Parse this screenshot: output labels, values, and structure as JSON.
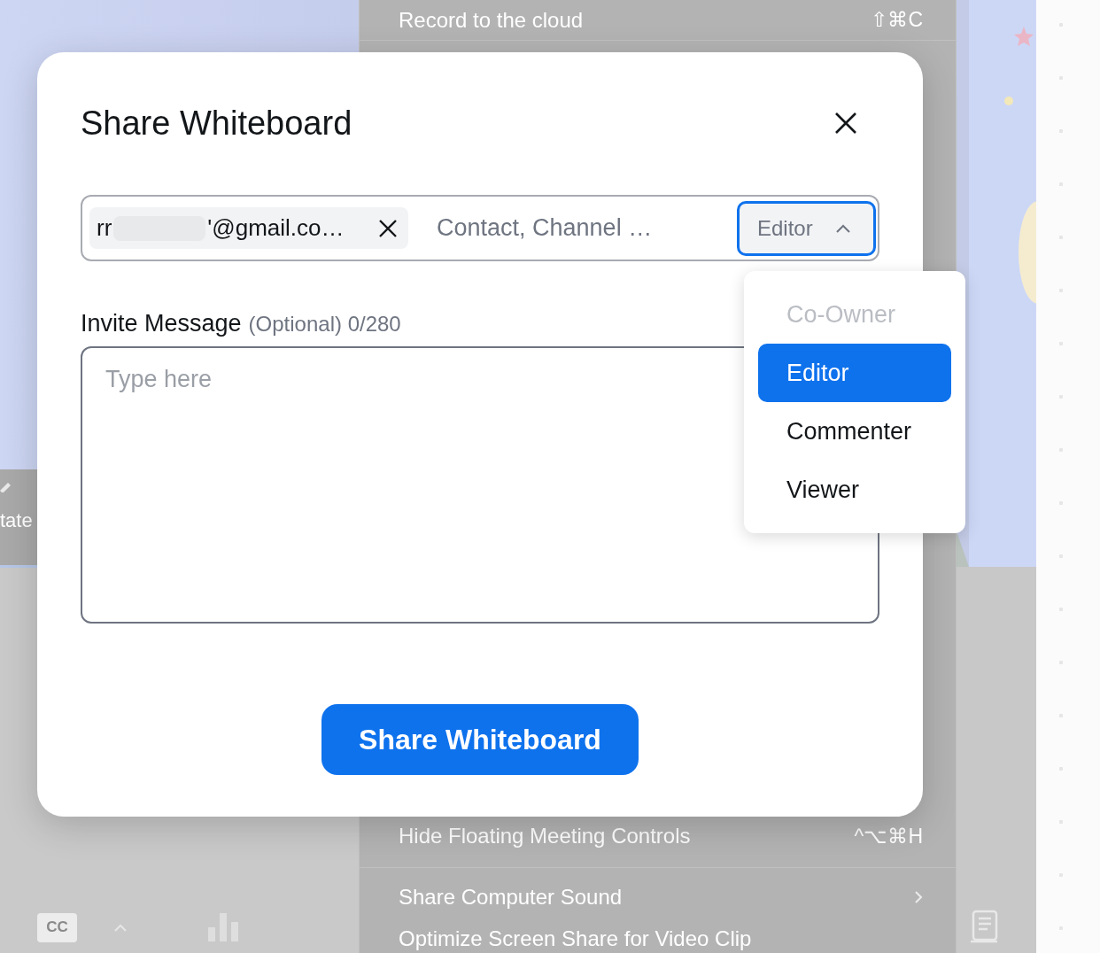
{
  "background": {
    "menu_items": [
      {
        "kind": "shortcut",
        "label": "Record to the cloud",
        "shortcut": "⇧⌘C"
      },
      {
        "kind": "shortcut",
        "label": "Hide Floating Meeting Controls",
        "shortcut": "^⌥⌘H"
      },
      {
        "kind": "submenu",
        "label": "Share Computer Sound"
      },
      {
        "kind": "plain",
        "label": "Optimize Screen Share for Video Clip"
      }
    ],
    "side_tool": {
      "label": "tate"
    },
    "toolbar": {
      "cc_label": "CC"
    }
  },
  "dialog": {
    "title": "Share Whiteboard",
    "recipient_chip": {
      "text_start": "rr",
      "text_end": "'@gmail.co…"
    },
    "recipient_field": {
      "placeholder": "Contact, Channel …"
    },
    "role_select": {
      "value": "Editor",
      "expanded": true
    },
    "role_options": [
      {
        "label": "Co-Owner",
        "selected": false,
        "disabled": true
      },
      {
        "label": "Editor",
        "selected": true,
        "disabled": false
      },
      {
        "label": "Commenter",
        "selected": false,
        "disabled": false
      },
      {
        "label": "Viewer",
        "selected": false,
        "disabled": false
      }
    ],
    "message_label": "Invite Message",
    "message_hint": "(Optional) 0/280",
    "message_field": {
      "placeholder": "Type here"
    },
    "submit_button": "Share Whiteboard"
  }
}
